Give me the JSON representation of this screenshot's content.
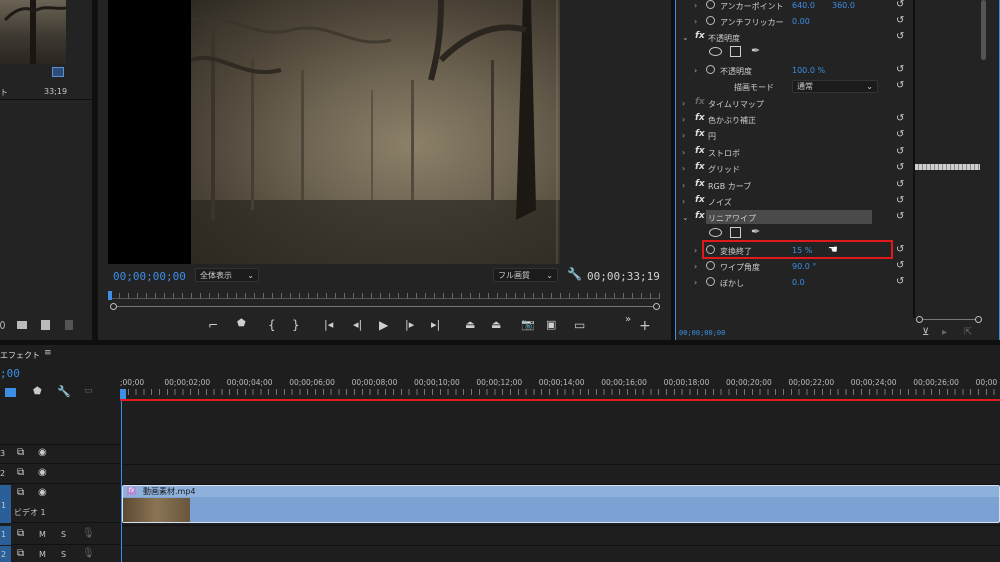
{
  "project_panel": {
    "item_meta": "ト",
    "item_duration": "33;19"
  },
  "program_monitor": {
    "current_timecode": "00;00;00;00",
    "zoom_select": "全体表示",
    "quality_select": "フル画質",
    "total_duration": "00;00;33;19"
  },
  "effect_controls": {
    "rows_top": [
      {
        "label": "アンカーポイント",
        "v1": "640.0",
        "v2": "360.0"
      },
      {
        "label": "アンチフリッカー",
        "v1": "0.00"
      }
    ],
    "opacity": {
      "label": "不透明度",
      "param_label": "不透明度",
      "param_value": "100.0 %",
      "blend_label": "描画モード",
      "blend_value": "通常"
    },
    "effects": [
      "タイムリマップ",
      "色かぶり補正",
      "円",
      "ストロボ",
      "グリッド",
      "RGB カーブ",
      "ノイズ"
    ],
    "linear_wipe": {
      "label": "リニアワイプ",
      "params": [
        {
          "label": "変換終了",
          "value": "15 %"
        },
        {
          "label": "ワイプ角度",
          "value": "90.0 °"
        },
        {
          "label": "ぼかし",
          "value": "0.0"
        }
      ]
    },
    "footer_timecode": "00;00;00;00"
  },
  "timeline": {
    "panel_title": "エフェクト",
    "current_timecode": ";00",
    "ruler_labels": [
      ";00;00",
      "00;00;02;00",
      "00;00;04;00",
      "00;00;06;00",
      "00;00;08;00",
      "00;00;10;00",
      "00;00;12;00",
      "00;00;14;00",
      "00;00;16;00",
      "00;00;18;00",
      "00;00;20;00",
      "00;00;22;00",
      "00;00;24;00",
      "00;00;26;00",
      "00;00"
    ],
    "video_track_name": "ビデオ 1",
    "track_codes": [
      "3",
      "2",
      "1",
      "1",
      "2"
    ],
    "clip_name": "動画素材.mp4",
    "mute_label": "M",
    "solo_label": "S"
  },
  "colors": {
    "accent": "#3d8ee5",
    "highlight": "#e0191e",
    "clip": "#7ba2d2",
    "playhead": "#e0191e"
  }
}
